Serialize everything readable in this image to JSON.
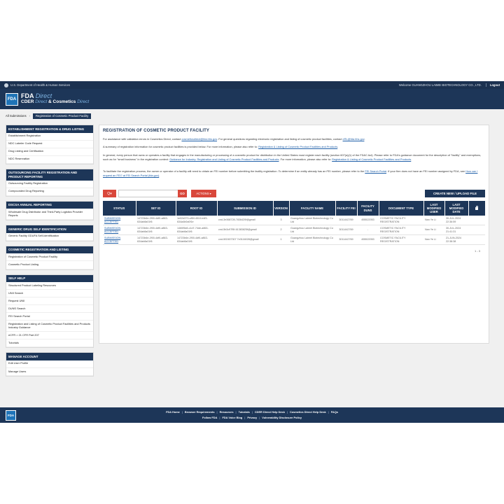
{
  "hhs_bar": {
    "agency": "U.S. Department of Health & Human Services",
    "welcome": "Welcome GUANGZHOU LAIMEI BIOTECHNOLOGY CO., LTD.",
    "logout": "Logout"
  },
  "header": {
    "logo": "FDA",
    "fda": "FDA",
    "direct": "Direct",
    "cder": "CDER",
    "direct2": "Direct",
    "amp": "&",
    "cosmetics": "Cosmetics",
    "direct3": "Direct"
  },
  "breadcrumb": {
    "root": "All Submissions",
    "sep": "›",
    "current": "Registration of Cosmetic Product Facility"
  },
  "sidebar": [
    {
      "title": "ESTABLISHMENT REGISTRATION & DRUG LISTING",
      "items": [
        "Establishment Registration",
        "NDC Labeler Code Request",
        "Drug Listing and Certification",
        "NDC Reservation"
      ]
    },
    {
      "title": "OUTSOURCING FACILITY REGISTRATION AND PRODUCT REPORTING",
      "items": [
        "Outsourcing Facility Registration",
        "Compounded Drug Reporting"
      ]
    },
    {
      "title": "DSCSA ANNUAL REPORTING",
      "items": [
        "Wholesale Drug Distributor and Third-Party Logistics Provider Reports"
      ]
    },
    {
      "title": "GENERIC DRUG SELF IDENTIFICATION",
      "items": [
        "Generic Facility GDUFA Self-Identification"
      ]
    },
    {
      "title": "COSMETIC REGISTRATION AND LISTING",
      "items": [
        "Registration of Cosmetic Product Facility",
        "Cosmetic Product Listing"
      ]
    },
    {
      "title": "SELF HELP",
      "items": [
        "Structured Product Labeling Resources",
        "UNII Search",
        "Request UNII",
        "DUNS Search",
        "FEI Search Portal",
        "Registration and Listing of Cosmetic Product Facilities and Products Industry Guidance",
        "eCFR > 21 CFR Part 207",
        "Tutorials"
      ]
    },
    {
      "title": "MANAGE ACCOUNT",
      "items": [
        "Edit User Profile",
        "Manage Users"
      ]
    }
  ],
  "main": {
    "title": "REGISTRATION OF COSMETIC PRODUCT FACILITY",
    "p1": {
      "t1": "For assistance with validation errors in Cosmetics Direct, contact ",
      "l1": "cosmeticsdirect@fda.hhs.gov",
      "t2": ". For general questions regarding electronic registration and listing of cosmetic product facilities, contact ",
      "l2": "eRL@fda.hhs.gov",
      "t3": "."
    },
    "p2": {
      "t1": "A summary of registration information for cosmetic product facilities is provided below. For more information, please also refer to: ",
      "l1": "Registration & Listing of Cosmetic Product Facilities and Products",
      "t2": "."
    },
    "p3": {
      "t1": "In general, every person that owns or operates a facility that engages in the manufacturing or processing of a cosmetic product for distribution in the United States must register each facility (section 607(a)(1) of the FD&C Act). Please refer to FDA's guidance document for the description of \"facility\" and exemptions, such as for \"small business\" in the registration context: ",
      "l1": "Guidance for Industry: Registration and Listing of Cosmetic Product Facilities and Products",
      "t2": ". For more information, please also refer to: ",
      "l2": "Registration & Listing of Cosmetic Product Facilities and Products",
      "t3": "."
    },
    "p4": {
      "t1": "To facilitate the registration process, the owner or operator of a facility will need to obtain an FEI number before submitting the facility registration. To determine if an entity already has an FEI number, please refer to the ",
      "l1": "FEI Search Portal",
      "t2": ". If your firm does not have an FEI number assigned by FDA, see ",
      "l2": "How can I request an FEI? at FEI Search Portal (fda.gov)",
      "t3": "."
    },
    "toolbar": {
      "search_icon": "Q",
      "caret": "▾",
      "input_placeholder": "",
      "go": "GO",
      "actions": "ACTIONS",
      "create": "CREATE NEW / UPLOAD FILE"
    },
    "table": {
      "headers": [
        "STATUS",
        "SET ID",
        "ROOT ID",
        "SUBMISSION ID",
        "VERSION",
        "FACILITY NAME",
        "FACILITY FEI",
        "FACILITY DUNS",
        "DOCUMENT TYPE",
        "LAST MODIFIED USER",
        "LAST MODIFIED DATE"
      ],
      "rows": [
        [
          "SUBMISSION ACCEPTED",
          "14723b6e-2f00-4df0-a863-634ab8a01f6",
          "1e02d373-c85f-4510-b4f3-634a4b0a0f1e",
          "cnd-3e368728-7836420f@gmail",
          "3",
          "Guangzhou Laimei Biotechnology Co Ltd",
          "3011442769",
          "455522053",
          "COSMETIC FACILITY REGISTRATION",
          "Nan Ye Li",
          "30-JUL-2024 22:36:59"
        ],
        [
          "SUBMISSION ACCEPTED",
          "14723b6e-2f00-4df0-a863-634ab8a01f6",
          "1460f5d8-c1d7-74de-a863-634ab8a01f6",
          "cnd-5b3c97f5f-61383825f@gmail",
          "2",
          "Guangzhou Laimei Biotechnology Co Ltd",
          "3011442769",
          "-",
          "COSMETIC FACILITY REGISTRATION",
          "Nan Ye Li",
          "30-JUL-2024 21:41:31"
        ],
        [
          "SUBMISSION ACCEPTED",
          "14723b6e-2f00-4df0-a863-634ab8a01f6",
          "14723b6e-2f00-4df0-a863-634ab8a01f6",
          "cnd-502457307 7e3116028@gmail",
          "1",
          "Guangzhou Laimei Biotechnology Co Ltd",
          "3011442769",
          "455522053",
          "COSMETIC FACILITY REGISTRATION",
          "Nan Ye Li",
          "21-JUN-2024 22:38:38"
        ]
      ],
      "pager": "1 - 3"
    }
  },
  "footer": {
    "logo": "FDA",
    "row1": [
      "FDA Home",
      "Browser Requirements",
      "Resources",
      "Tutorials",
      "CDER Direct Help Desk",
      "Cosmetics Direct Help Desk",
      "FAQs"
    ],
    "row2": [
      "Follow FDA",
      "FDA Voice Blog",
      "Privacy",
      "Vulnerability Disclosure Policy"
    ],
    "sep": "|"
  },
  "colors": {
    "navy": "#1d3658",
    "red": "#d9473b",
    "link": "#1f5fa8"
  }
}
